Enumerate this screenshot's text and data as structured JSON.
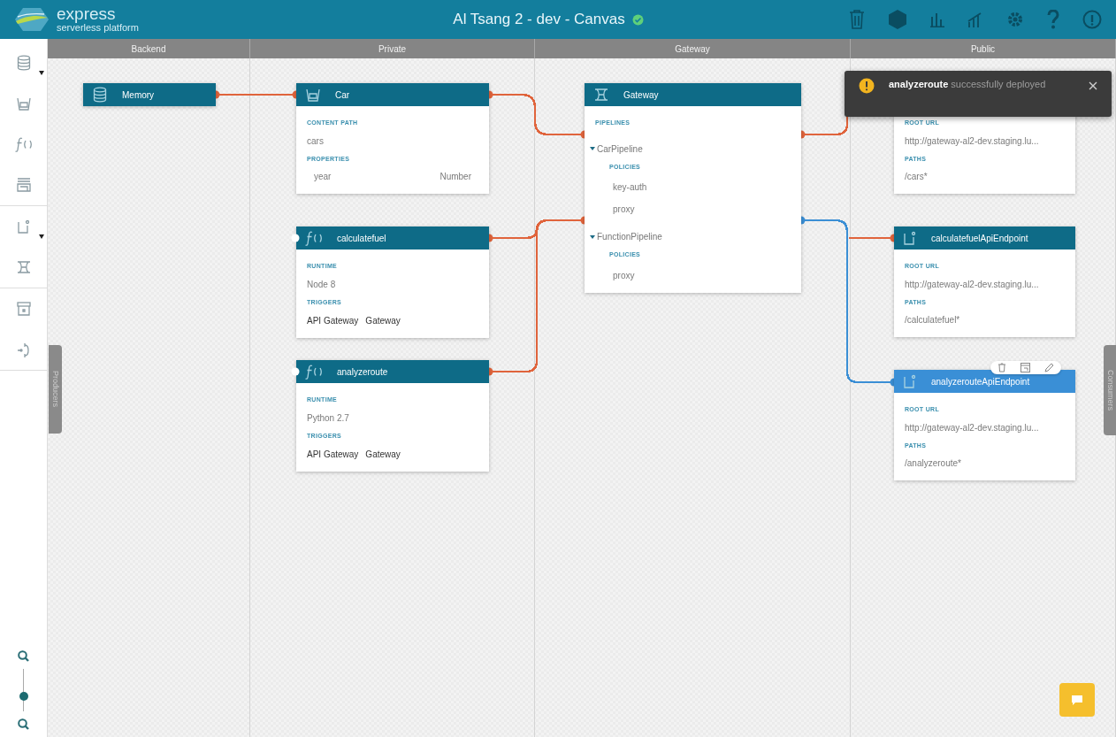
{
  "header": {
    "logo": {
      "name": "express",
      "tagline": "serverless platform"
    },
    "title": "Al Tsang 2 - dev - Canvas"
  },
  "lanes": [
    {
      "label": "Backend"
    },
    {
      "label": "Private"
    },
    {
      "label": "Gateway"
    },
    {
      "label": "Public"
    }
  ],
  "nodes": [
    {
      "kind": "resource",
      "title": "Memory",
      "selected": false
    },
    {
      "kind": "model",
      "title": "Car",
      "selected": false,
      "sections": [
        {
          "kind": "text",
          "label": "CONTENT PATH",
          "value": "cars"
        },
        {
          "kind": "fields",
          "label": "PROPERTIES",
          "rows": [
            {
              "name": "year",
              "type": "Number"
            }
          ]
        }
      ]
    },
    {
      "kind": "function",
      "title": "calculatefuel",
      "selected": false,
      "sections": [
        {
          "kind": "text",
          "label": "RUNTIME",
          "value": "Node 8"
        },
        {
          "kind": "tags",
          "label": "TRIGGERS",
          "items": [
            "API Gateway",
            "Gateway"
          ]
        }
      ]
    },
    {
      "kind": "function",
      "title": "analyzeroute",
      "selected": false,
      "sections": [
        {
          "kind": "text",
          "label": "RUNTIME",
          "value": "Python 2.7"
        },
        {
          "kind": "tags",
          "label": "TRIGGERS",
          "items": [
            "API Gateway",
            "Gateway"
          ]
        }
      ]
    },
    {
      "kind": "gateway",
      "title": "Gateway",
      "selected": false,
      "sections": [
        {
          "kind": "pipelines",
          "label": "PIPELINES",
          "pipelines": [
            {
              "name": "CarPipeline",
              "expanded": true,
              "policies_label": "POLICIES",
              "policies": [
                "key-auth",
                "proxy"
              ]
            },
            {
              "name": "FunctionPipeline",
              "expanded": true,
              "policies_label": "POLICIES",
              "policies": [
                "proxy"
              ]
            }
          ]
        }
      ]
    },
    {
      "kind": "endpoint",
      "sections": [
        {
          "kind": "text",
          "label": "ROOT URL",
          "value": "http://gateway-al2-dev.staging.lu..."
        },
        {
          "kind": "text",
          "label": "PATHS",
          "value": "/cars*"
        }
      ]
    },
    {
      "kind": "endpoint",
      "title": "calculatefuelApiEndpoint",
      "selected": false,
      "sections": [
        {
          "kind": "text",
          "label": "ROOT URL",
          "value": "http://gateway-al2-dev.staging.lu..."
        },
        {
          "kind": "text",
          "label": "PATHS",
          "value": "/calculatefuel*"
        }
      ]
    },
    {
      "kind": "endpoint",
      "title": "analyzerouteApiEndpoint",
      "selected": true,
      "sections": [
        {
          "kind": "text",
          "label": "ROOT URL",
          "value": "http://gateway-al2-dev.staging.lu..."
        },
        {
          "kind": "text",
          "label": "PATHS",
          "value": "/analyzeroute*"
        }
      ]
    }
  ],
  "connections": [
    {
      "color": "#e0643c"
    },
    {
      "color": "#e0643c"
    },
    {
      "color": "#e0643c"
    },
    {
      "color": "#e0643c"
    },
    {
      "color": "#e0643c"
    },
    {
      "color": "#e0643c"
    },
    {
      "color": "#3b8fd5"
    }
  ],
  "side_tabs": {
    "left": "Producers",
    "right": "Consumers"
  },
  "zoom": {
    "level": 0.35
  },
  "toast": {
    "message": "**analyzeroute** successfully deployed"
  }
}
